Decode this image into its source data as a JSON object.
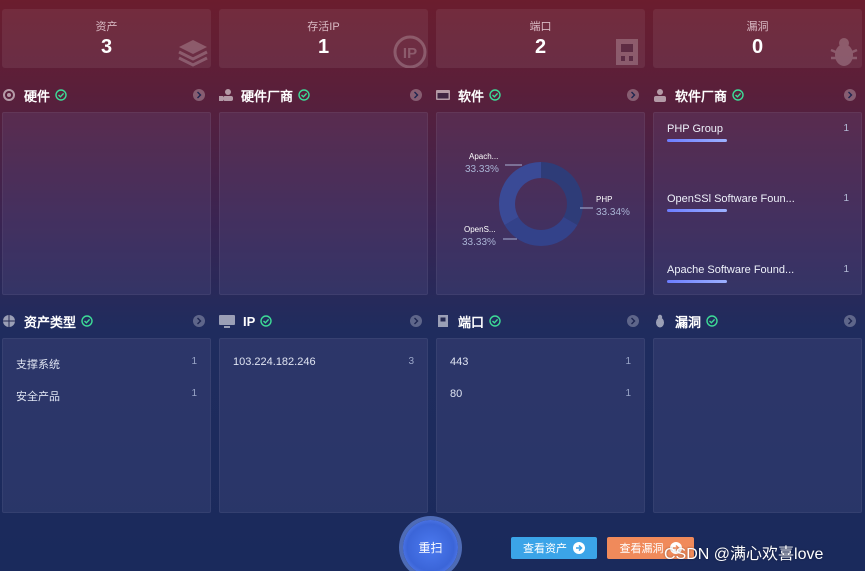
{
  "stats": [
    {
      "label": "资产",
      "value": "3",
      "icon": "layers-icon"
    },
    {
      "label": "存活IP",
      "value": "1",
      "icon": "ip-icon"
    },
    {
      "label": "端口",
      "value": "2",
      "icon": "port-icon"
    },
    {
      "label": "漏洞",
      "value": "0",
      "icon": "bug-icon"
    }
  ],
  "sections": {
    "hardware": {
      "title": "硬件"
    },
    "hardware_vendor": {
      "title": "硬件厂商"
    },
    "software": {
      "title": "软件",
      "donut": [
        {
          "name": "Apach...",
          "percent": "33.33%"
        },
        {
          "name": "OpenS...",
          "percent": "33.33%"
        },
        {
          "name": "PHP",
          "percent": "33.34%"
        }
      ]
    },
    "software_vendor": {
      "title": "软件厂商",
      "items": [
        {
          "name": "PHP Group",
          "count": "1"
        },
        {
          "name": "OpenSSl Software Foun...",
          "count": "1"
        },
        {
          "name": "Apache Software Found...",
          "count": "1"
        }
      ]
    },
    "asset_type": {
      "title": "资产类型",
      "items": [
        {
          "name": "支撑系统",
          "count": "1"
        },
        {
          "name": "安全产品",
          "count": "1"
        }
      ]
    },
    "ip": {
      "title": "IP",
      "items": [
        {
          "name": "103.224.182.246",
          "count": "3"
        }
      ]
    },
    "port": {
      "title": "端口",
      "items": [
        {
          "name": "443",
          "count": "1"
        },
        {
          "name": "80",
          "count": "1"
        }
      ]
    },
    "vuln": {
      "title": "漏洞"
    }
  },
  "actions": {
    "rescan": "重扫",
    "view_assets": "查看资产",
    "view_vulns": "查看漏洞"
  },
  "watermark": "CSDN @满心欢喜love",
  "colors": {
    "check": "#3ddc97",
    "assets_button": "#3ba4e8",
    "vulns_button": "#f08a5b",
    "rescan_button": "#3b65d8"
  }
}
